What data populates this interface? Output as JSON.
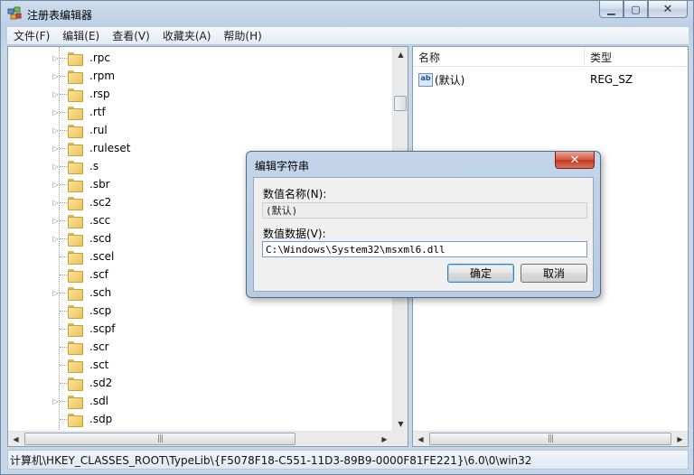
{
  "window": {
    "title": "注册表编辑器",
    "minimize_glyph": "▁",
    "maximize_glyph": "▢",
    "close_glyph": "✕"
  },
  "menu": [
    "文件(F)",
    "编辑(E)",
    "查看(V)",
    "收藏夹(A)",
    "帮助(H)"
  ],
  "tree": {
    "items": [
      {
        "label": ".rpc",
        "expandable": true
      },
      {
        "label": ".rpm",
        "expandable": true
      },
      {
        "label": ".rsp",
        "expandable": true
      },
      {
        "label": ".rtf",
        "expandable": true
      },
      {
        "label": ".rul",
        "expandable": true
      },
      {
        "label": ".ruleset",
        "expandable": true
      },
      {
        "label": ".s",
        "expandable": true
      },
      {
        "label": ".sbr",
        "expandable": true
      },
      {
        "label": ".sc2",
        "expandable": true
      },
      {
        "label": ".scc",
        "expandable": true
      },
      {
        "label": ".scd",
        "expandable": true
      },
      {
        "label": ".scel",
        "expandable": false
      },
      {
        "label": ".scf",
        "expandable": false
      },
      {
        "label": ".sch",
        "expandable": true
      },
      {
        "label": ".scp",
        "expandable": false
      },
      {
        "label": ".scpf",
        "expandable": false
      },
      {
        "label": ".scr",
        "expandable": false
      },
      {
        "label": ".sct",
        "expandable": false
      },
      {
        "label": ".sd2",
        "expandable": false
      },
      {
        "label": ".sdl",
        "expandable": true
      },
      {
        "label": ".sdp",
        "expandable": false
      }
    ]
  },
  "list": {
    "columns": {
      "name": "名称",
      "type": "类型"
    },
    "rows": [
      {
        "icon": "string-value-icon",
        "icon_text": "ab",
        "name": "(默认)",
        "type": "REG_SZ"
      }
    ]
  },
  "statusbar": {
    "path": "计算机\\HKEY_CLASSES_ROOT\\TypeLib\\{F5078F18-C551-11D3-89B9-0000F81FE221}\\6.0\\0\\win32"
  },
  "dialog": {
    "title": "编辑字符串",
    "close_glyph": "✕",
    "name_label": "数值名称(N):",
    "name_value": "(默认)",
    "data_label": "数值数据(V):",
    "data_value": "C:\\Windows\\System32\\msxml6.dll",
    "ok_label": "确定",
    "cancel_label": "取消"
  },
  "scroll": {
    "up": "▲",
    "down": "▼",
    "left": "◀",
    "right": "▶",
    "grip": "|||"
  }
}
